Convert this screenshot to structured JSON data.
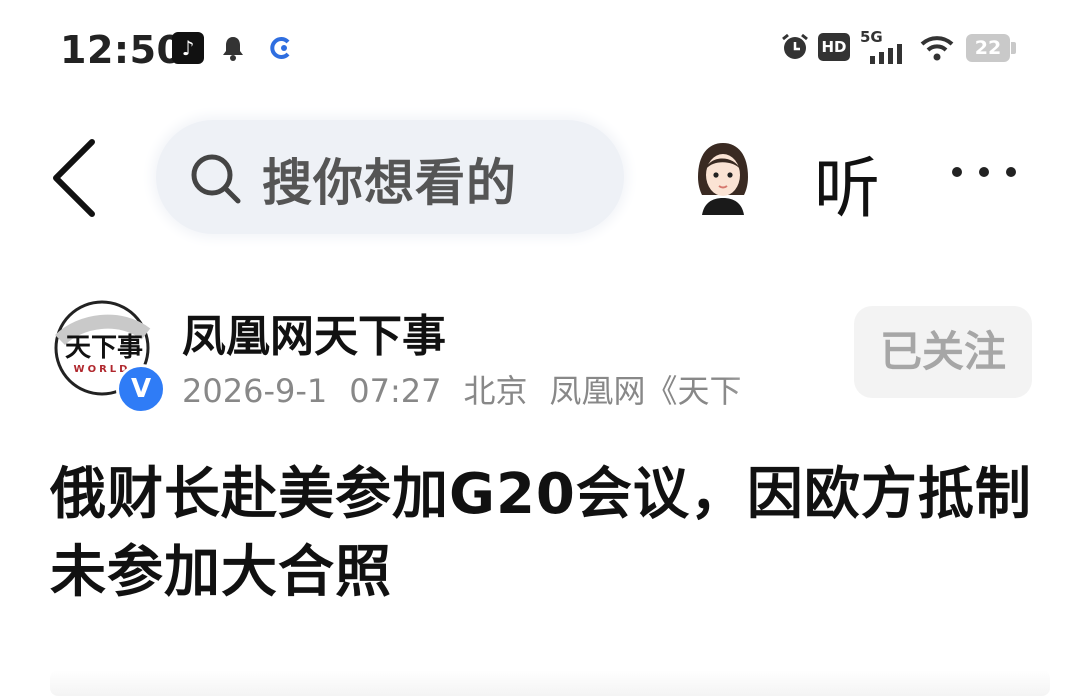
{
  "status_bar": {
    "time": "12:50",
    "network": "5G",
    "hd_label": "HD",
    "battery": "22",
    "icons": [
      "tiktok-icon",
      "bell-icon",
      "c-app-icon",
      "alarm-icon",
      "signal-icon",
      "wifi-icon",
      "battery-icon"
    ]
  },
  "toolbar": {
    "search_placeholder": "搜你想看的",
    "listen_label": "听",
    "icons": [
      "back-icon",
      "search-icon",
      "avatar",
      "more-icon"
    ]
  },
  "author": {
    "name": "凤凰网天下事",
    "logo_text": "天下事",
    "logo_subtext": "WORLD",
    "verified_mark": "V",
    "date": "2026-9-1",
    "time": "07:27",
    "location": "北京",
    "source": "凤凰网《天下",
    "follow_label": "已关注"
  },
  "article": {
    "title": "俄财长赴美参加G20会议，因欧方抵制未参加大合照"
  },
  "colors": {
    "background": "#ffffff",
    "search_bg": "#eef1f6",
    "verified_blue": "#2f7cf6",
    "meta_gray": "#888888",
    "follow_bg": "#f3f3f3"
  }
}
